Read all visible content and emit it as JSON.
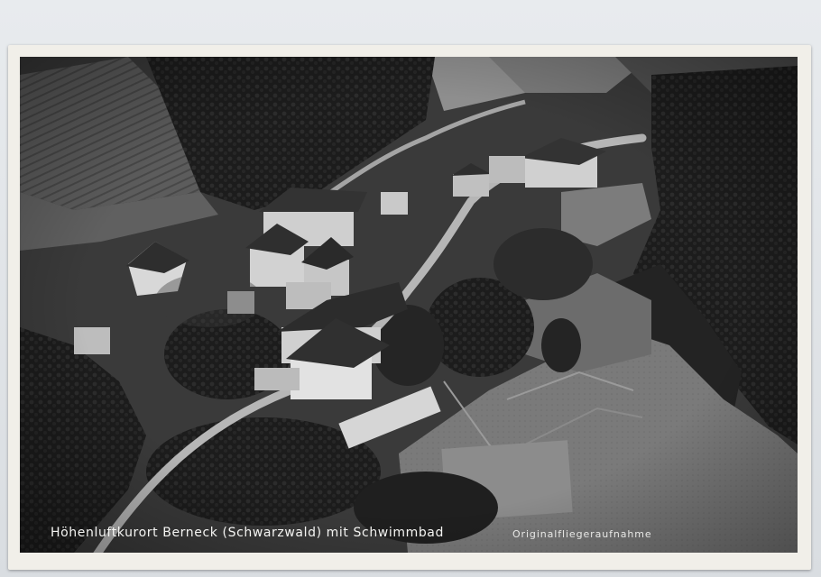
{
  "postcard": {
    "caption": "Höhenluftkurort Berneck (Schwarzwald) mit Schwimmbad",
    "credit": "Originalfliegeraufnahme"
  },
  "photo": {
    "subject": "aerial-village-photo",
    "tone": "black-and-white"
  },
  "colors": {
    "card": "#f1efe9",
    "background": "#dfe2e6"
  }
}
